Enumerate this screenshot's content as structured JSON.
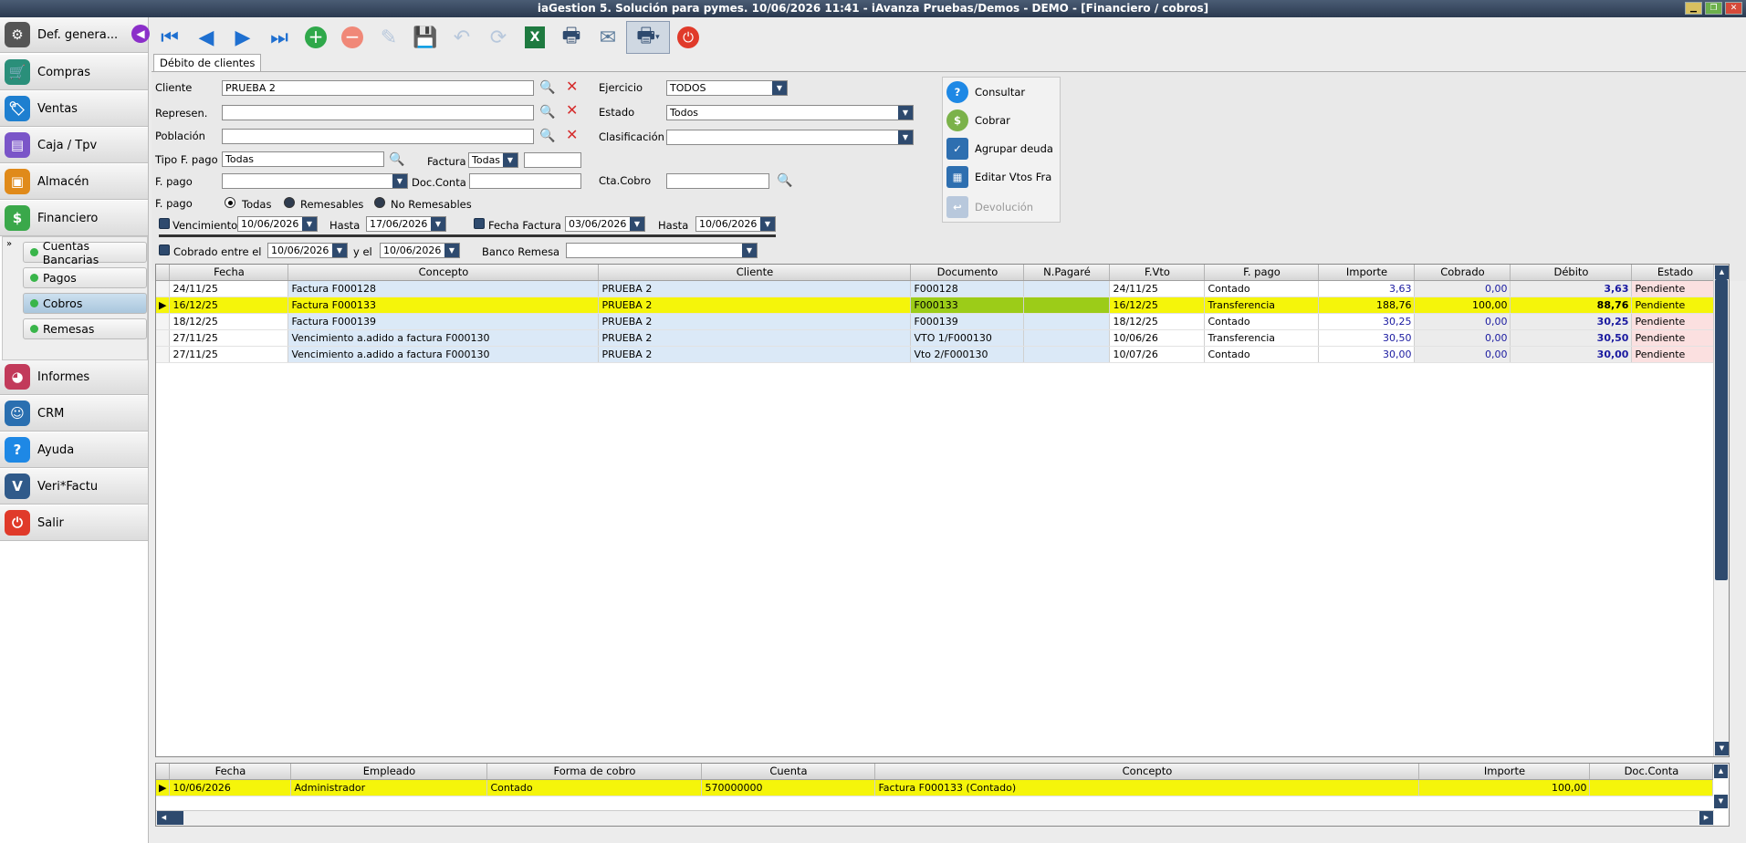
{
  "window": {
    "title": "iaGestion 5. Solución para pymes.  10/06/2026 11:41  -  iAvanza Pruebas/Demos - DEMO - [Financiero / cobros]"
  },
  "sidebar": {
    "items": [
      {
        "label": "Def. genera...",
        "icon": "gear-icon",
        "color": "#555555"
      },
      {
        "label": "Compras",
        "icon": "cart-icon",
        "color": "#2a8f7a"
      },
      {
        "label": "Ventas",
        "icon": "tags-icon",
        "color": "#1e7fd0"
      },
      {
        "label": "Caja / Tpv",
        "icon": "register-icon",
        "color": "#7a55c8"
      },
      {
        "label": "Almacén",
        "icon": "warehouse-icon",
        "color": "#e08a1a"
      },
      {
        "label": "Financiero",
        "icon": "money-icon",
        "color": "#3aa84a"
      },
      {
        "label": "Informes",
        "icon": "report-icon",
        "color": "#c23a5a"
      },
      {
        "label": "CRM",
        "icon": "person-icon",
        "color": "#2a6fb0"
      },
      {
        "label": "Ayuda",
        "icon": "help-icon",
        "color": "#1e88e5"
      },
      {
        "label": "Veri*Factu",
        "icon": "verifactu-icon",
        "color": "#305a8a"
      },
      {
        "label": "Salir",
        "icon": "power-icon",
        "color": "#e03a2a"
      }
    ],
    "sub_items": [
      {
        "label": "Cuentas Bancarias"
      },
      {
        "label": "Pagos"
      },
      {
        "label": "Cobros"
      },
      {
        "label": "Remesas"
      }
    ]
  },
  "tab": "Débito de clientes",
  "form": {
    "cliente_label": "Cliente",
    "cliente_value": "PRUEBA 2",
    "represen_label": "Represen.",
    "poblacion_label": "Población",
    "tipofpago_label": "Tipo F. pago",
    "tipofpago_value": "Todas",
    "factura_label": "Factura",
    "factura_value": "Todas",
    "fpago_label": "F. pago",
    "docconta_label": "Doc.Conta",
    "fpago2_label": "F. pago",
    "radio_todas": "Todas",
    "radio_remesables": "Remesables",
    "radio_noremesables": "No Remesables",
    "vencimiento_label": "Vencimiento",
    "vencimiento_value": "10/06/2026",
    "hasta_label": "Hasta",
    "hasta_value": "17/06/2026",
    "fechafactura_label": "Fecha Factura",
    "fechafactura_value": "03/06/2026",
    "hasta2_label": "Hasta",
    "hasta2_value": "10/06/2026",
    "cobrado_label": "Cobrado entre el",
    "cobrado_value": "10/06/2026",
    "yel_label": "y el",
    "yel_value": "10/06/2026",
    "bancoremesa_label": "Banco Remesa",
    "ejercicio_label": "Ejercicio",
    "ejercicio_value": "TODOS",
    "estado_label": "Estado",
    "estado_value": "Todos",
    "clasificacion_label": "Clasificación",
    "ctacobro_label": "Cta.Cobro"
  },
  "actions": [
    {
      "label": "Consultar"
    },
    {
      "label": "Cobrar"
    },
    {
      "label": "Agrupar deuda"
    },
    {
      "label": "Editar Vtos Fra"
    },
    {
      "label": "Devolución"
    }
  ],
  "grid": {
    "columns": [
      "Fecha",
      "Concepto",
      "Cliente",
      "Documento",
      "N.Pagaré",
      "F.Vto",
      "F. pago",
      "Importe",
      "Cobrado",
      "Débito",
      "Estado"
    ],
    "rows": [
      [
        "24/11/25",
        "Factura F000128",
        "PRUEBA 2",
        "F000128",
        "",
        "24/11/25",
        "Contado",
        "3,63",
        "0,00",
        "3,63",
        "Pendiente"
      ],
      [
        "16/12/25",
        "Factura F000133",
        "PRUEBA 2",
        "F000133",
        "",
        "16/12/25",
        "Transferencia",
        "188,76",
        "100,00",
        "88,76",
        "Pendiente"
      ],
      [
        "18/12/25",
        "Factura F000139",
        "PRUEBA 2",
        "F000139",
        "",
        "18/12/25",
        "Contado",
        "30,25",
        "0,00",
        "30,25",
        "Pendiente"
      ],
      [
        "27/11/25",
        "Vencimiento a.adido a factura F000130",
        "PRUEBA 2",
        "VTO 1/F000130",
        "",
        "10/06/26",
        "Transferencia",
        "30,50",
        "0,00",
        "30,50",
        "Pendiente"
      ],
      [
        "27/11/25",
        "Vencimiento a.adido a factura F000130",
        "PRUEBA 2",
        "Vto 2/F000130",
        "",
        "10/07/26",
        "Contado",
        "30,00",
        "0,00",
        "30,00",
        "Pendiente"
      ]
    ],
    "selected_row": 1
  },
  "bottom": {
    "columns": [
      "Fecha",
      "Empleado",
      "Forma de cobro",
      "Cuenta",
      "Concepto",
      "Importe",
      "Doc.Conta"
    ],
    "rows": [
      [
        "10/06/2026",
        "Administrador",
        "Contado",
        "570000000",
        "Factura F000133 (Contado)",
        "100,00",
        ""
      ]
    ]
  }
}
